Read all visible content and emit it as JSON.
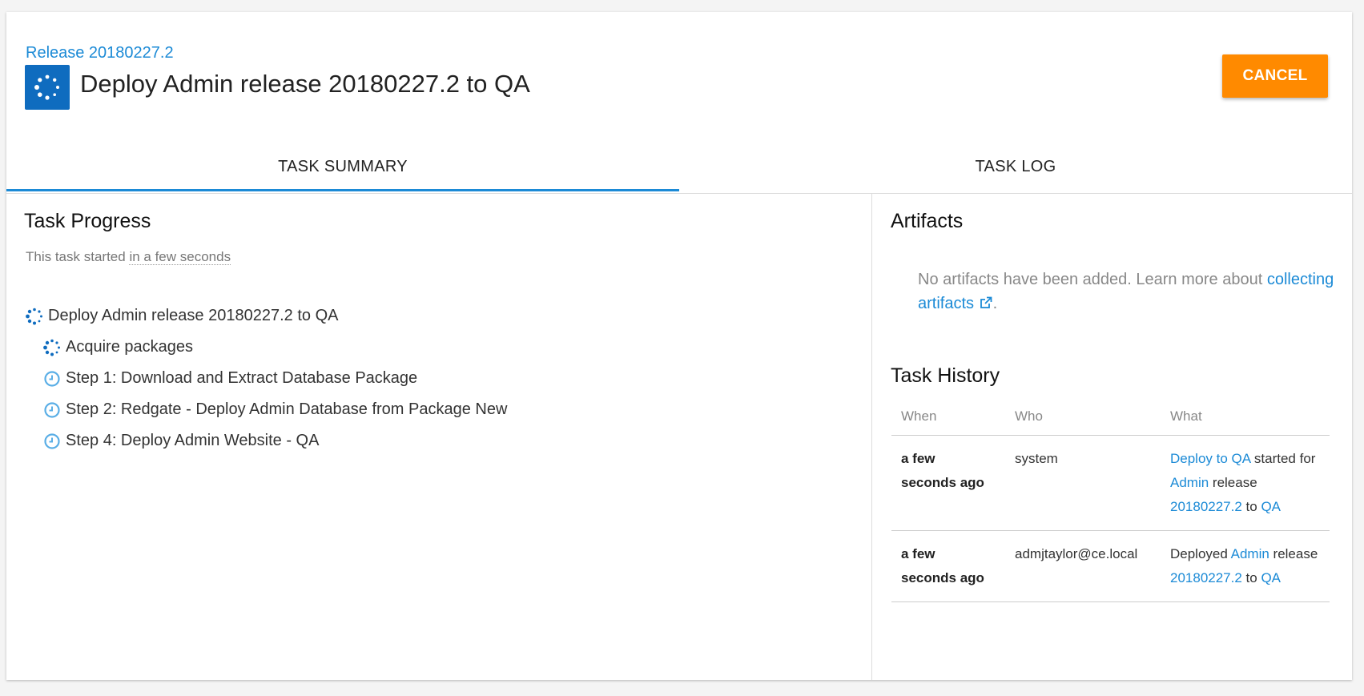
{
  "header": {
    "breadcrumb": "Release 20180227.2",
    "title": "Deploy Admin release 20180227.2 to QA",
    "cancel_label": "CANCEL",
    "task_icon": "spinner-icon"
  },
  "tabs": [
    {
      "label": "TASK SUMMARY",
      "active": true
    },
    {
      "label": "TASK LOG",
      "active": false
    }
  ],
  "progress": {
    "heading": "Task Progress",
    "started_prefix": "This task started",
    "started_relative": "in a few seconds",
    "steps": [
      {
        "label": "Deploy Admin release 20180227.2 to QA",
        "icon": "spinner-icon",
        "level": 0
      },
      {
        "label": "Acquire packages",
        "icon": "spinner-icon",
        "level": 1
      },
      {
        "label": "Step 1: Download and Extract Database Package",
        "icon": "clock-icon",
        "level": 1
      },
      {
        "label": "Step 2: Redgate - Deploy Admin Database from Package New",
        "icon": "clock-icon",
        "level": 1
      },
      {
        "label": "Step 4: Deploy Admin Website - QA",
        "icon": "clock-icon",
        "level": 1
      }
    ]
  },
  "artifacts": {
    "heading": "Artifacts",
    "message": "No artifacts have been added. Learn more about",
    "link_label": "collecting artifacts",
    "suffix": "."
  },
  "history": {
    "heading": "Task History",
    "columns": [
      "When",
      "Who",
      "What"
    ],
    "rows": [
      {
        "when_1": "a few",
        "when_2": "seconds ago",
        "who": "system",
        "what": {
          "link1": "Deploy to QA",
          "t1": " started for ",
          "link2": "Admin",
          "t2": " release ",
          "link3": "20180227.2",
          "t3": " to ",
          "link4": "QA"
        }
      },
      {
        "when_1": "a few",
        "when_2": "seconds ago",
        "who": "admjtaylor@ce.local",
        "what": {
          "t0": "Deployed ",
          "link1": "Admin",
          "t1": " release ",
          "link2": "20180227.2",
          "t2": " to ",
          "link3": "QA"
        }
      }
    ]
  },
  "colors": {
    "accent": "#1b8ad6",
    "cancel": "#ff8a00",
    "task_icon_bg": "#0f6cbf"
  }
}
